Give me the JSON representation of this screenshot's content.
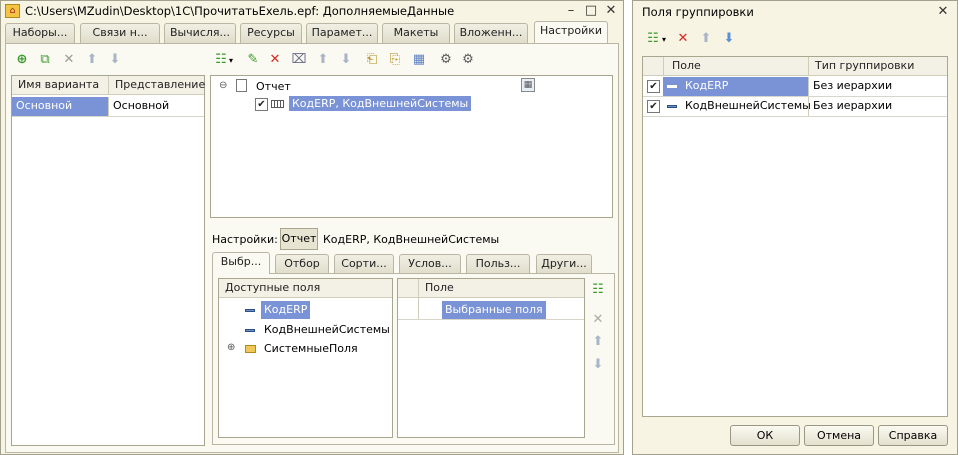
{
  "main_window": {
    "title": "C:\\Users\\MZudin\\Desktop\\1С\\ПрочитатьExeль.epf: ДополняемыеДанные",
    "tabs": [
      "Наборы...",
      "Связи н...",
      "Вычисля...",
      "Ресурсы",
      "Парамет...",
      "Макеты",
      "Вложенн...",
      "Настройки"
    ],
    "variants_table": {
      "headers": [
        "Имя варианта",
        "Представление"
      ],
      "rows": [
        [
          "Основной",
          "Основной"
        ]
      ]
    },
    "structure_tree": {
      "root": "Отчет",
      "child": "КодERP, КодВнешнейСистемы"
    },
    "settings_label": "Настройки:",
    "settings_button": "Отчет",
    "settings_value": "КодERP, КодВнешнейСистемы",
    "sub_tabs": [
      "Выбр...",
      "Отбор",
      "Сорти...",
      "Услов...",
      "Польз...",
      "Други..."
    ],
    "available_fields": {
      "header": "Доступные поля",
      "items": [
        "КодERP",
        "КодВнешнейСистемы",
        "СистемныеПоля"
      ]
    },
    "selected_fields": {
      "header": "Поле",
      "placeholder_row": "Выбранные поля"
    }
  },
  "dialog": {
    "title": "Поля группировки",
    "headers": [
      "Поле",
      "Тип группировки"
    ],
    "rows": [
      {
        "field": "КодERP",
        "type": "Без иерархии",
        "checked": true
      },
      {
        "field": "КодВнешнейСистемы",
        "type": "Без иерархии",
        "checked": true
      }
    ],
    "buttons": {
      "ok": "ОК",
      "cancel": "Отмена",
      "help": "Справка"
    }
  },
  "colors": {
    "selection": "#7a93d6",
    "window_bg": "#f7f4e3",
    "delete_red": "#d9281e",
    "add_green": "#3a9a2c"
  }
}
